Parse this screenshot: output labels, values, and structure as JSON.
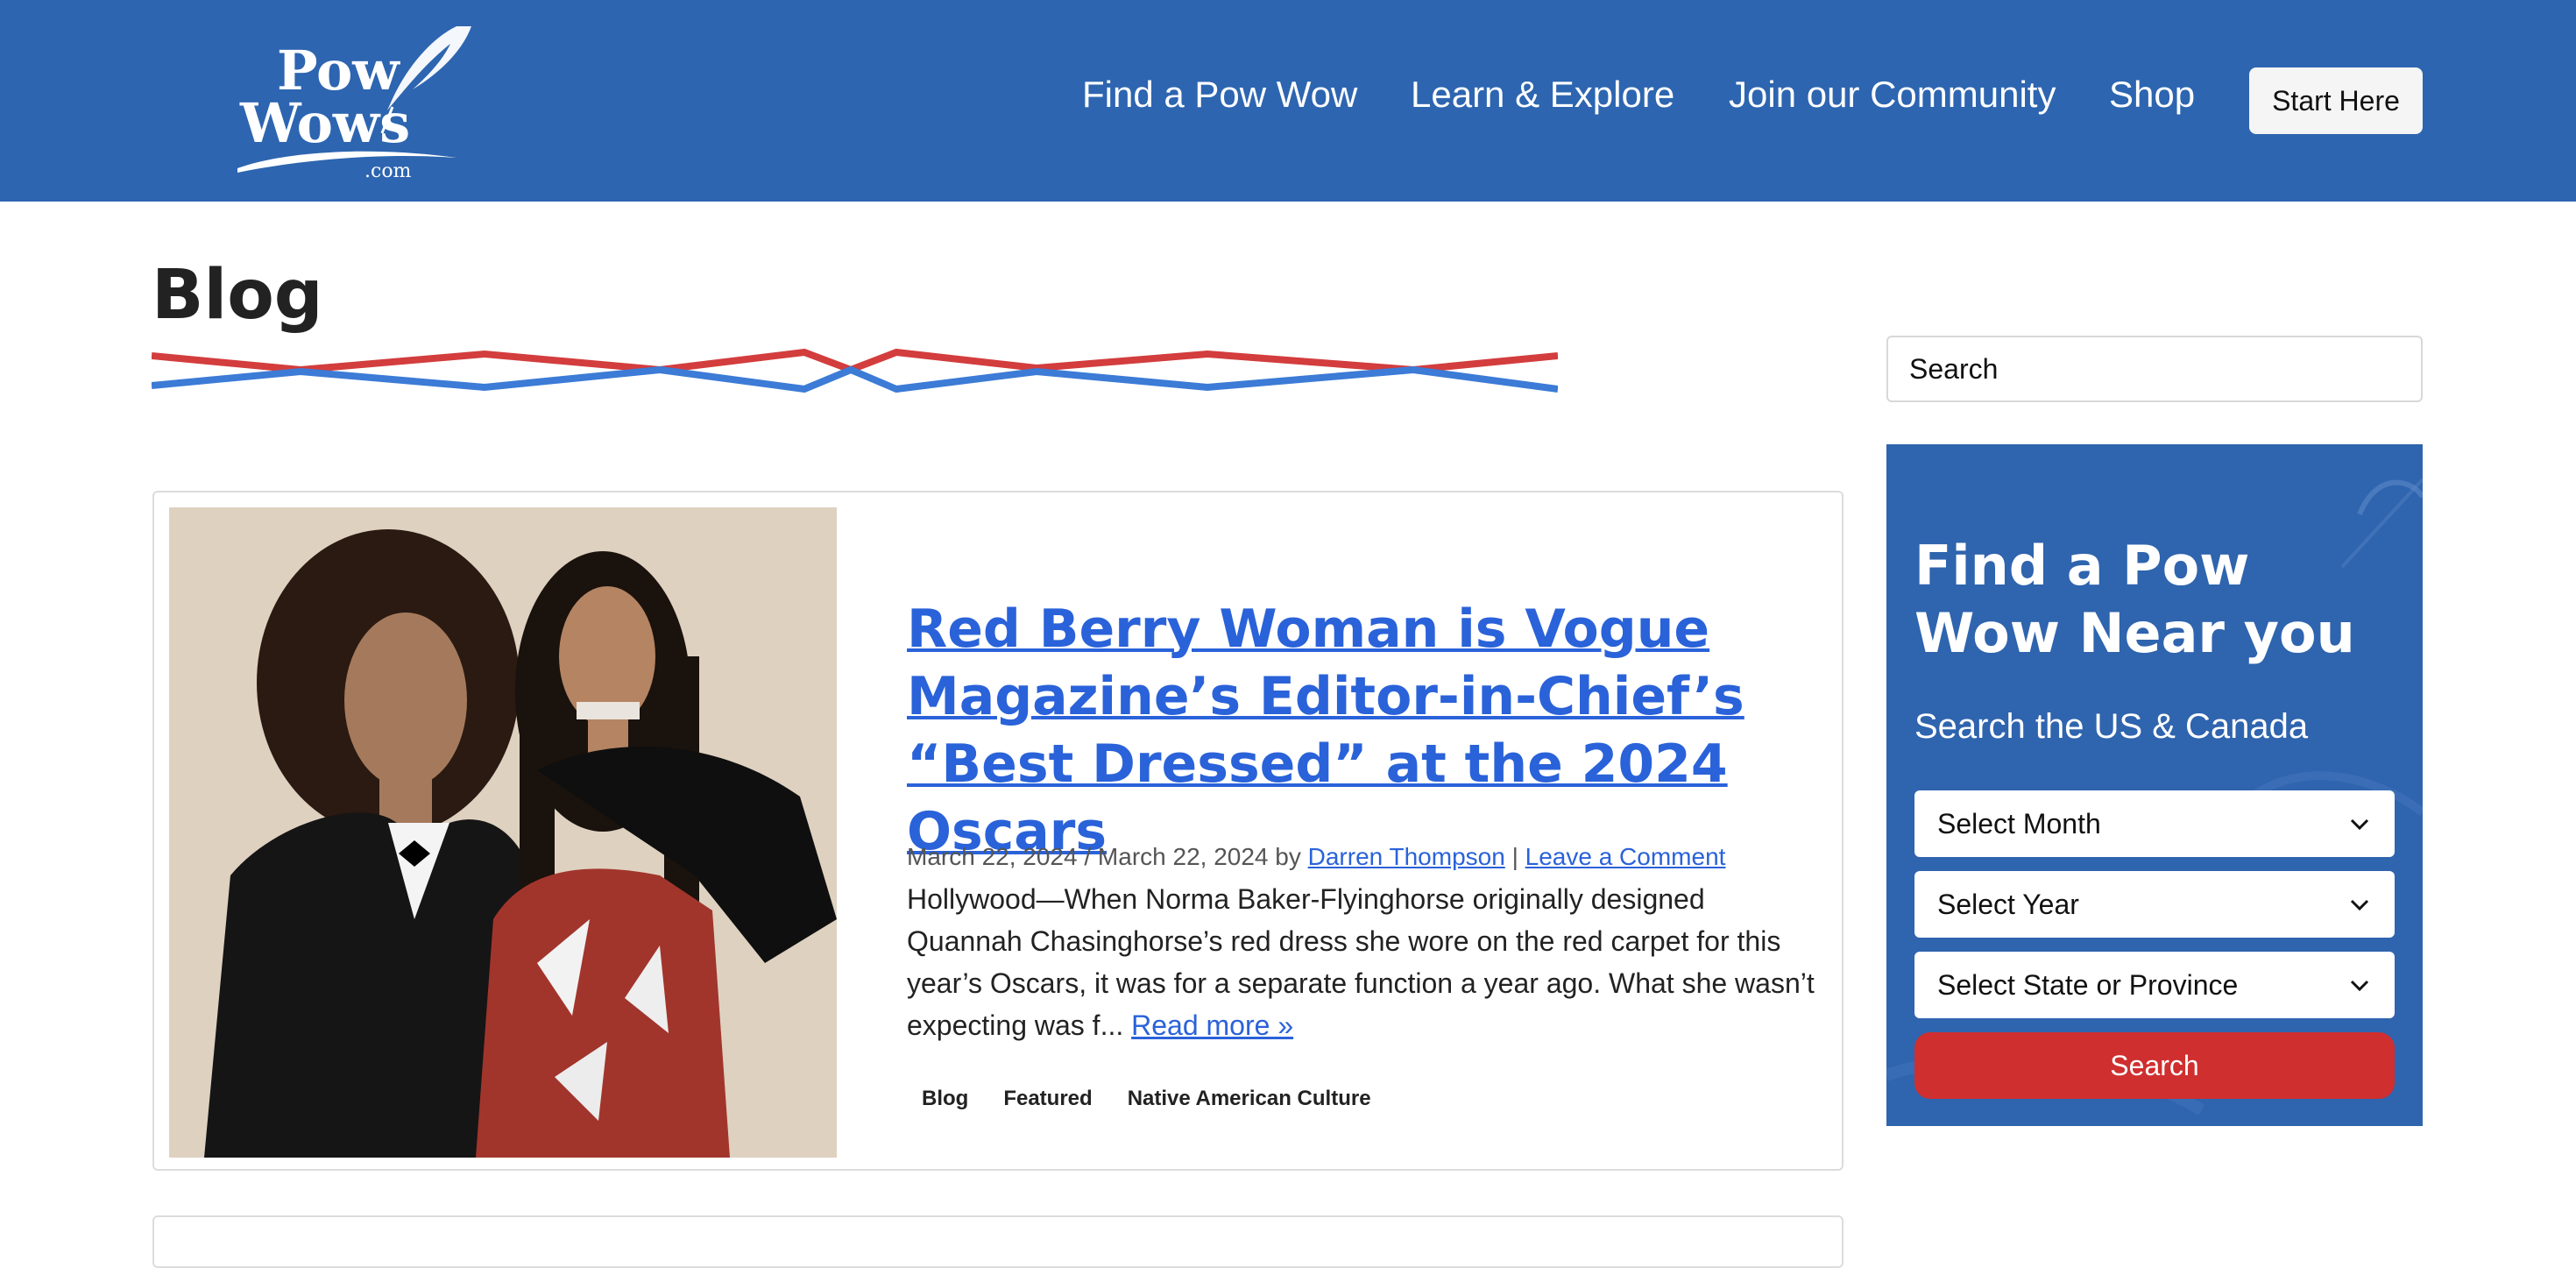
{
  "colors": {
    "brand": "#2d65b0",
    "link": "#2a62d9",
    "accent": "#cf2f2f"
  },
  "header": {
    "logo_text": "Pow Wows .com",
    "nav": [
      "Find a Pow Wow",
      "Learn & Explore",
      "Join our Community",
      "Shop"
    ],
    "start_label": "Start Here"
  },
  "page": {
    "title": "Blog"
  },
  "post": {
    "title": "Red Berry Woman is Vogue Magazine’s Editor-in-Chief’s “Best Dressed” at the 2024 Oscars",
    "date_published": "March 22, 2024",
    "date_separator": " / ",
    "date_updated": "March 22, 2024",
    "by": " by ",
    "author": "Darren Thompson",
    "separator": " | ",
    "comment_link": "Leave a Comment",
    "excerpt": "Hollywood—When Norma Baker-Flyinghorse originally designed Quannah Chasinghorse’s red dress she wore on the red carpet for this year’s Oscars, it was for a separate function a year ago. What she wasn’t expecting was f...",
    "read_more": "Read more »",
    "tags": [
      "Blog",
      "Featured",
      "Native American Culture"
    ]
  },
  "sidebar": {
    "search_placeholder": "Search",
    "widget": {
      "title": "Find a Pow Wow Near you",
      "subtitle": "Search the US & Canada",
      "select_month": "Select Month",
      "select_year": "Select Year",
      "select_state": "Select State or Province",
      "search_button": "Search"
    }
  }
}
